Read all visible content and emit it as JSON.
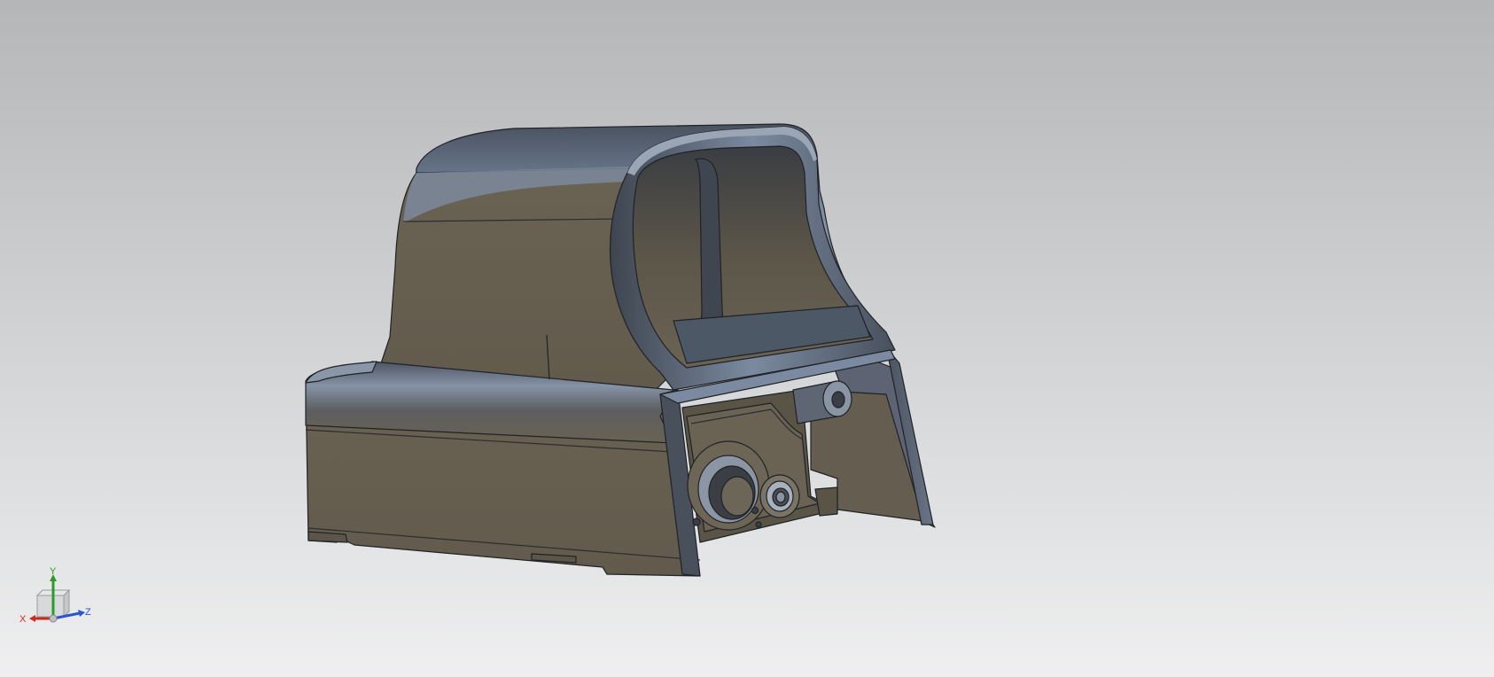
{
  "viewport": {
    "background_top": "#b5b6b8",
    "background_bottom": "#efeff0"
  },
  "model": {
    "body_color": "#675f50",
    "edge_color": "#1f2226",
    "highlight_color": "#7a8aa0"
  },
  "triad": {
    "x_label": "X",
    "y_label": "Y",
    "z_label": "Z",
    "x_color": "#d02a1e",
    "y_color": "#2c9a2c",
    "z_color": "#2a55d0"
  }
}
